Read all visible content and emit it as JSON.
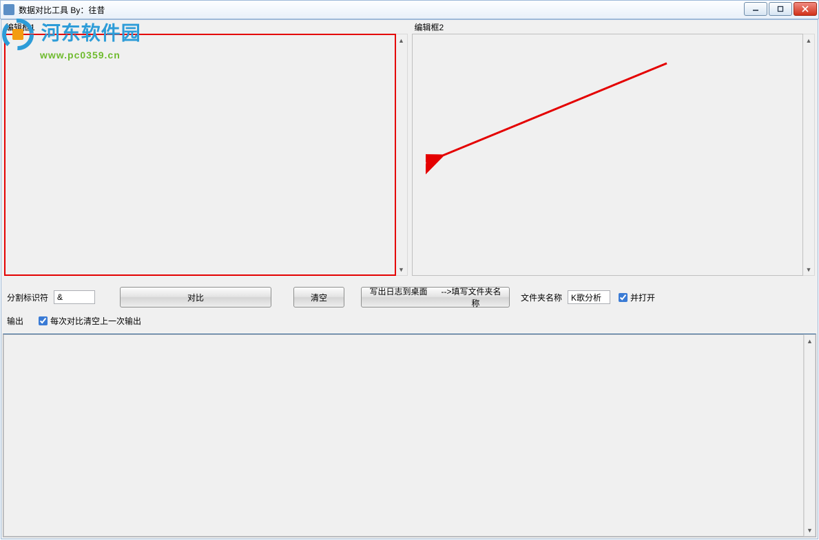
{
  "window": {
    "title": "数据对比工具  By：往昔"
  },
  "panes": {
    "label1": "编辑框1",
    "label2": "编辑框2"
  },
  "controls": {
    "separator_label": "分割标识符",
    "separator_value": "&",
    "compare_label": "对比",
    "clear_label": "清空",
    "write_desktop_label": "写出日志到桌面      -->填写文件夹名\n                                   称",
    "folder_label": "文件夹名称",
    "folder_value": "K歌分析",
    "and_open_label": "并打开",
    "and_open_checked": true
  },
  "output": {
    "label": "输出",
    "clear_each_label": "每次对比清空上一次输出",
    "clear_each_checked": true
  },
  "watermark": {
    "site_name": "河东软件园",
    "site_url": "www.pc0359.cn"
  }
}
